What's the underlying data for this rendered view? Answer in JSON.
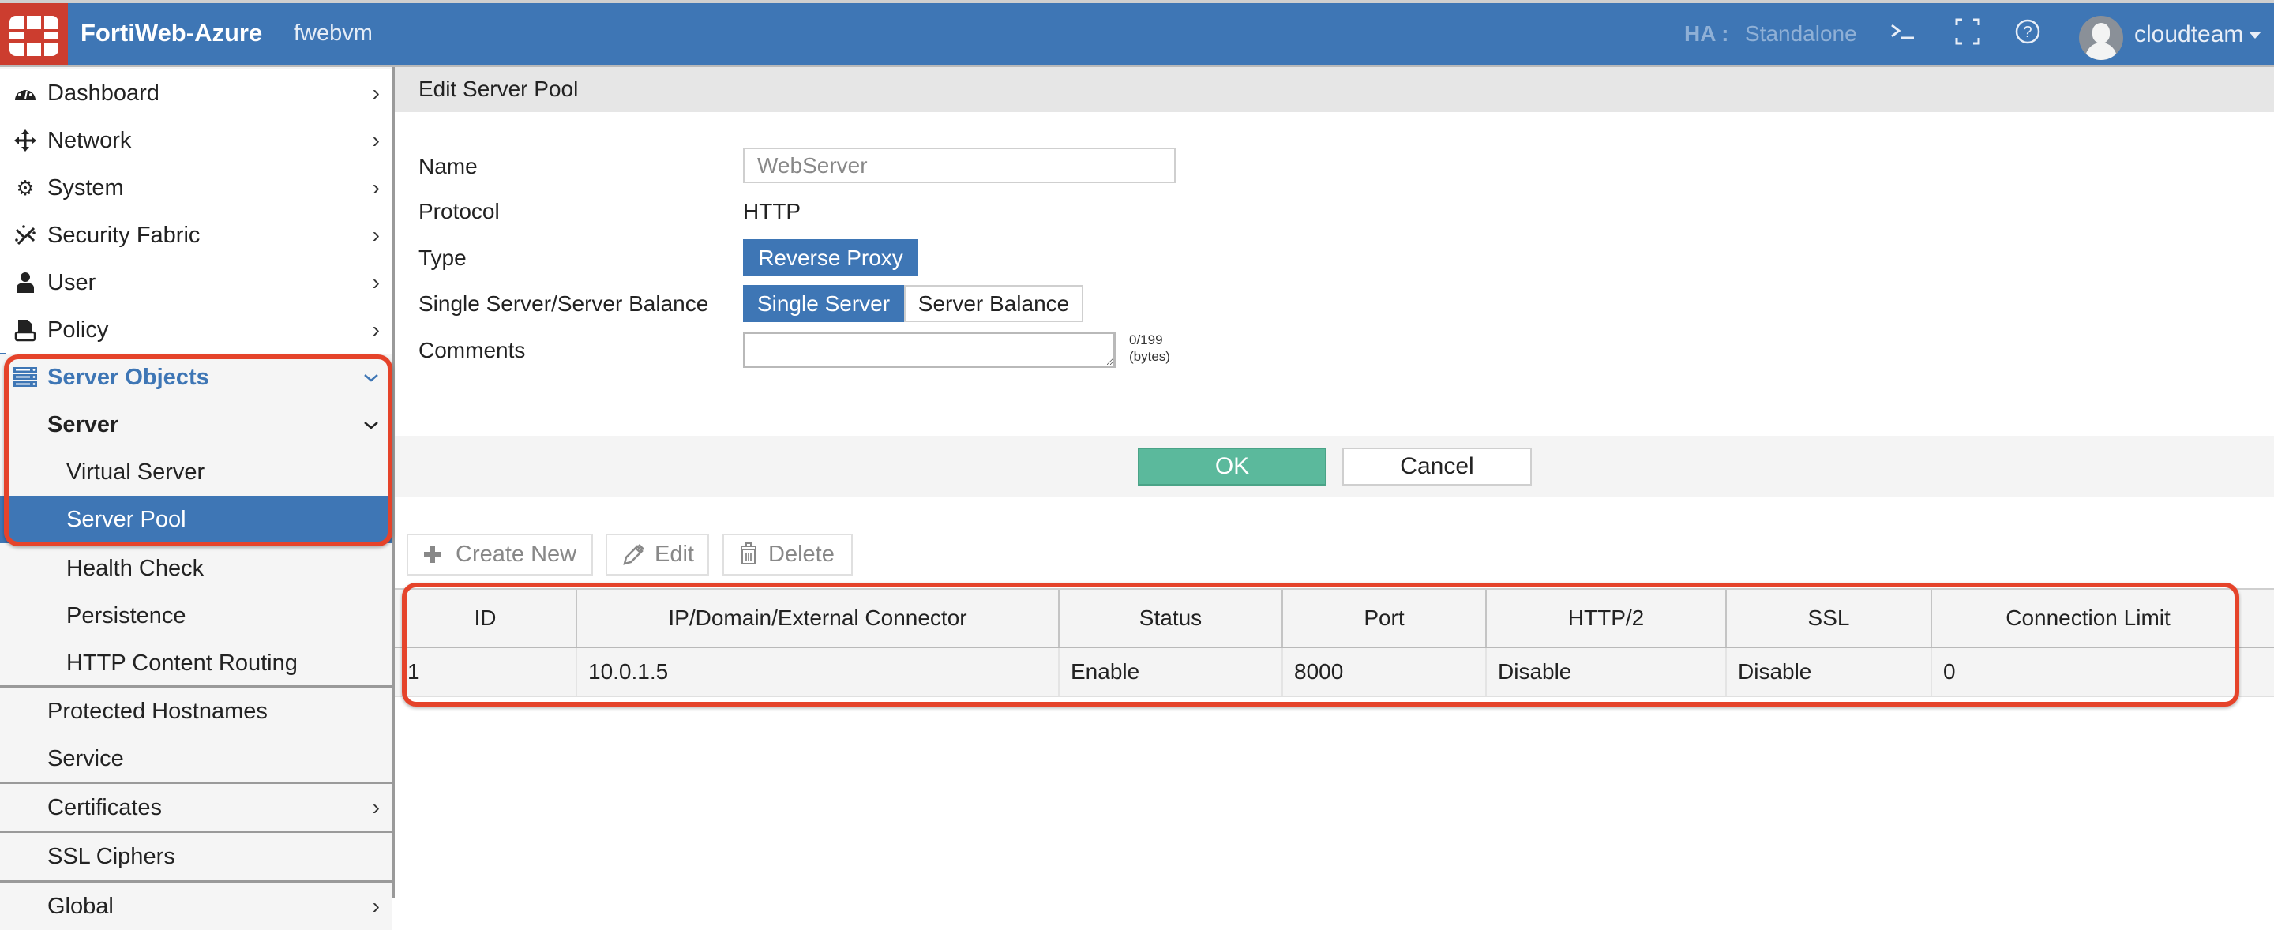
{
  "header": {
    "app_title": "FortiWeb-Azure",
    "host_name": "fwebvm",
    "ha_label": "HA :",
    "ha_value": "Standalone",
    "cli_icon": "terminal-icon",
    "fullscreen_icon": "fullscreen-icon",
    "help_icon": "help-icon",
    "user_name": "cloudteam",
    "logo": "fortinet-logo"
  },
  "sidebar": {
    "items": [
      {
        "label": "Dashboard",
        "icon": "dashboard-icon"
      },
      {
        "label": "Network",
        "icon": "network-icon"
      },
      {
        "label": "System",
        "icon": "gear-icon"
      },
      {
        "label": "Security Fabric",
        "icon": "security-fabric-icon"
      },
      {
        "label": "User",
        "icon": "user-icon"
      },
      {
        "label": "Policy",
        "icon": "policy-icon"
      },
      {
        "label": "Server Objects",
        "icon": "server-icon"
      },
      {
        "label": "Server"
      },
      {
        "label": "Virtual Server"
      },
      {
        "label": "Server Pool"
      },
      {
        "label": "Health Check"
      },
      {
        "label": "Persistence"
      },
      {
        "label": "HTTP Content Routing"
      },
      {
        "label": "Protected Hostnames"
      },
      {
        "label": "Service"
      },
      {
        "label": "Certificates"
      },
      {
        "label": "SSL Ciphers"
      },
      {
        "label": "Global"
      }
    ]
  },
  "form": {
    "title": "Edit Server Pool",
    "name_label": "Name",
    "name_value": "WebServer",
    "protocol_label": "Protocol",
    "protocol_value": "HTTP",
    "type_label": "Type",
    "type_value": "Reverse Proxy",
    "balance_label": "Single Server/Server Balance",
    "balance_options": [
      "Single Server",
      "Server Balance"
    ],
    "balance_selected": "Single Server",
    "comments_label": "Comments",
    "comments_value": "",
    "comments_counter": "0/199",
    "comments_unit": "(bytes)",
    "ok_label": "OK",
    "cancel_label": "Cancel"
  },
  "toolbar": {
    "create_label": "Create New",
    "edit_label": "Edit",
    "delete_label": "Delete"
  },
  "table": {
    "columns": [
      "ID",
      "IP/Domain/External Connector",
      "Status",
      "Port",
      "HTTP/2",
      "SSL",
      "Connection Limit"
    ],
    "rows": [
      [
        "1",
        "10.0.1.5",
        "Enable",
        "8000",
        "Disable",
        "Disable",
        "0"
      ]
    ]
  },
  "colors": {
    "brand_blue": "#3e76b5",
    "logo_red": "#cc3d2f",
    "ok_green": "#5bb99c",
    "highlight_red": "#e5432a"
  }
}
